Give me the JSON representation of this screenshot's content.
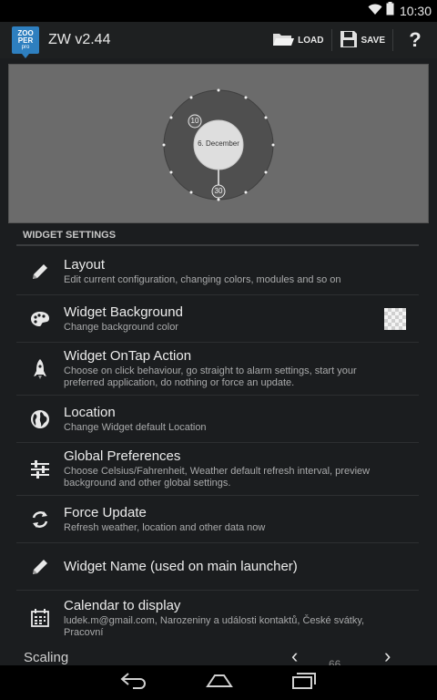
{
  "status_bar": {
    "time": "10:30",
    "icons": [
      "wifi-icon",
      "battery-icon"
    ]
  },
  "action_bar": {
    "logo_lines": [
      "ZOO",
      "PER",
      "pro"
    ],
    "title": "ZW v2.44",
    "load_label": "LOAD",
    "save_label": "SAVE",
    "help_label": "?"
  },
  "preview": {
    "date_text": "6. December",
    "badge_top": "10",
    "badge_bottom": "30",
    "background_color": "#6b6b6b"
  },
  "section_header": "WIDGET SETTINGS",
  "settings": [
    {
      "icon": "pencil-icon",
      "title": "Layout",
      "summary": "Edit current configuration, changing colors, modules and so on"
    },
    {
      "icon": "palette-icon",
      "title": "Widget Background",
      "summary": "Change background color",
      "swatch": "transparent"
    },
    {
      "icon": "rocket-icon",
      "title": "Widget OnTap Action",
      "summary": "Choose on click behaviour, go straight to alarm settings, start your preferred application, do nothing or force an update."
    },
    {
      "icon": "globe-icon",
      "title": "Location",
      "summary": "Change Widget default Location"
    },
    {
      "icon": "sliders-icon",
      "title": "Global Preferences",
      "summary": "Choose Celsius/Fahrenheit, Weather default refresh interval, preview background and other global settings."
    },
    {
      "icon": "refresh-icon",
      "title": "Force Update",
      "summary": "Refresh weather, location and other data now"
    },
    {
      "icon": "pencil-icon",
      "title": "Widget Name (used on main launcher)",
      "summary": ""
    },
    {
      "icon": "calendar-icon",
      "title": "Calendar to display",
      "summary": "ludek.m@gmail.com, Narozeniny a události kontaktů, České svátky, Pracovní"
    }
  ],
  "scaling": {
    "label": "Scaling",
    "value": "66"
  },
  "nav_bar": {
    "icons": [
      "back-icon",
      "home-icon",
      "recents-icon"
    ]
  }
}
